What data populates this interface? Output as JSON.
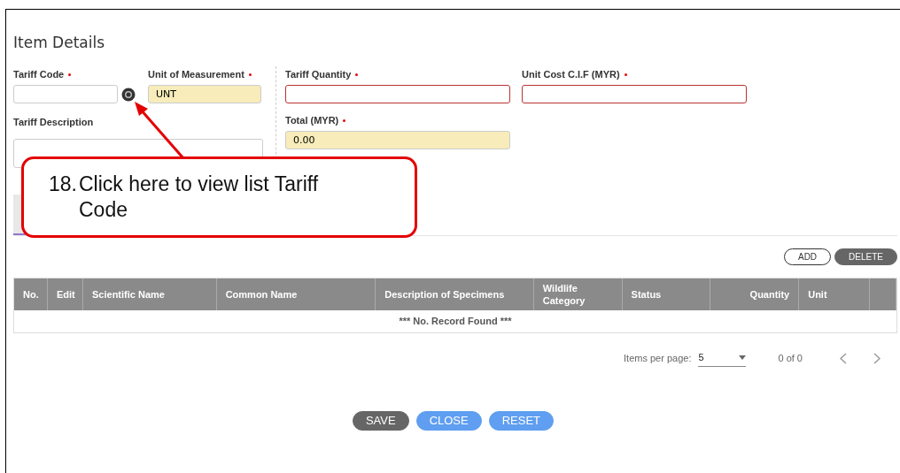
{
  "title": "Item Details",
  "fields": [
    {
      "label": "Tariff Code",
      "kind": "lookup",
      "required": true,
      "readonly": false,
      "invalid": false
    },
    {
      "label": "Unit of Measurement",
      "kind": "text",
      "required": true,
      "value": "UNT",
      "readonly": true,
      "invalid": false
    },
    {
      "label": "Tariff Quantity",
      "kind": "text",
      "required": true,
      "readonly": false,
      "invalid": true
    },
    {
      "label": "Unit Cost C.I.F (MYR)",
      "kind": "text",
      "required": true,
      "readonly": false,
      "invalid": true
    },
    {
      "label": "Tariff Description",
      "kind": "textarea",
      "required": false,
      "readonly": false,
      "invalid": false
    },
    {
      "label": "Total (MYR)",
      "kind": "text",
      "required": true,
      "value": "0.00",
      "readonly": true,
      "invalid": false
    }
  ],
  "callout": {
    "number": "18.",
    "text": "Click here to view list Tariff Code"
  },
  "table_actions": [
    {
      "label": "ADD",
      "kind": "outline"
    },
    {
      "label": "DELETE",
      "kind": "dark"
    }
  ],
  "table": {
    "columns": [
      {
        "label": "No.",
        "kind": "text"
      },
      {
        "label": "Edit",
        "kind": "text"
      },
      {
        "label": "Scientific Name",
        "kind": "text"
      },
      {
        "label": "Common Name",
        "kind": "text"
      },
      {
        "label": "Description of Specimens",
        "kind": "text"
      },
      {
        "label": "Wildlife Category",
        "kind": "text"
      },
      {
        "label": "Status",
        "kind": "text"
      },
      {
        "label": "Quantity",
        "kind": "number"
      },
      {
        "label": "Unit",
        "kind": "text"
      },
      {
        "kind": "text"
      }
    ],
    "empty_message": "*** No. Record Found ***"
  },
  "paginator": {
    "label": "Items per page:",
    "page_size": "5",
    "range": "0 of 0"
  },
  "buttons": [
    {
      "label": "SAVE",
      "kind": "dark"
    },
    {
      "label": "CLOSE",
      "kind": "primary"
    },
    {
      "label": "RESET",
      "kind": "primary"
    }
  ]
}
